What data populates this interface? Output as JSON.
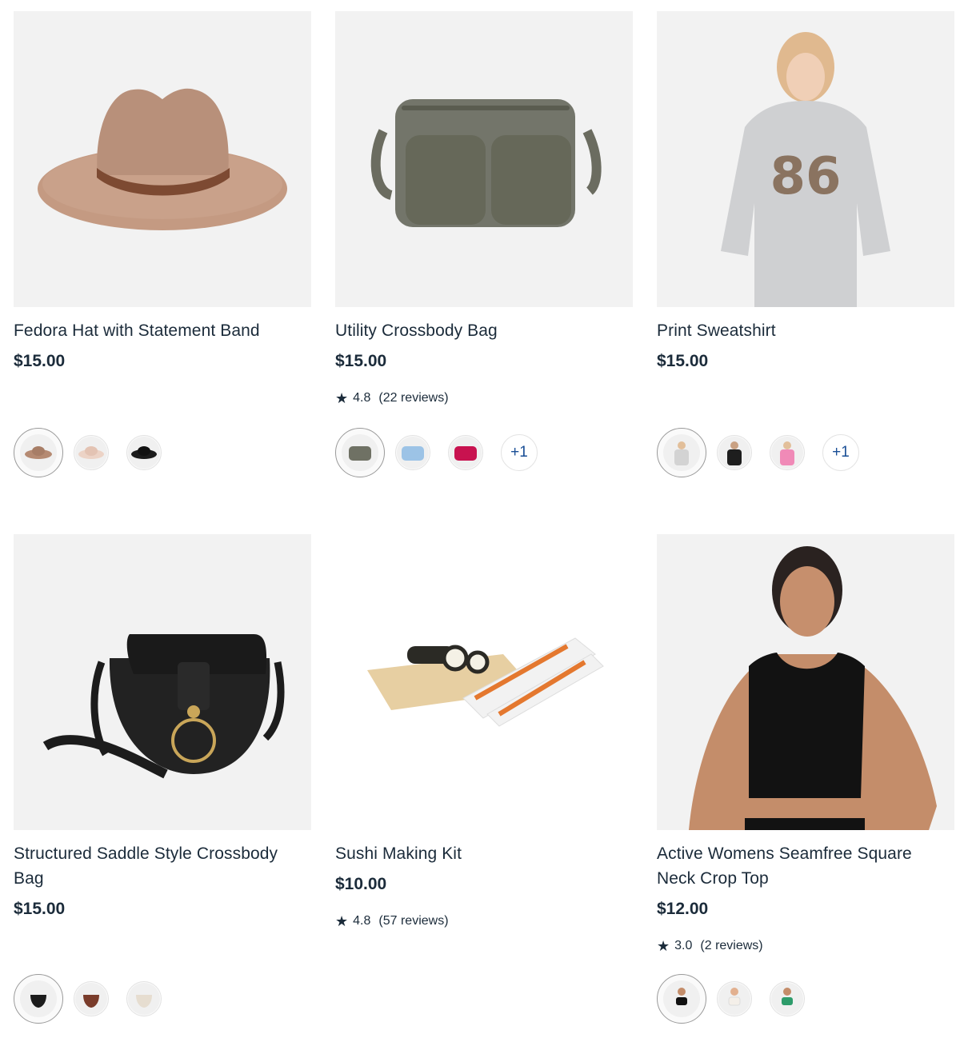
{
  "products": [
    {
      "title": "Fedora Hat with Statement Band",
      "price": "$15.00",
      "image": "fedora-hat-image",
      "swatches": [
        "tan-fedora",
        "blush-fedora",
        "black-fedora"
      ],
      "colors": [
        "#b58a72",
        "#ecd3c6",
        "#1b1b1b"
      ]
    },
    {
      "title": "Utility Crossbody Bag",
      "price": "$15.00",
      "rating": "4.8",
      "reviews": "(22 reviews)",
      "image": "crossbody-bag-image",
      "swatches": [
        "khaki-bag",
        "blue-bag",
        "pink-bag"
      ],
      "colors": [
        "#6f7164",
        "#9cc3e6",
        "#c8124f"
      ],
      "more": "+1"
    },
    {
      "title": "Print Sweatshirt",
      "price": "$15.00",
      "image": "sweatshirt-image",
      "swatches": [
        "grey-sweatshirt",
        "black-sweatshirt",
        "pink-sweatshirt"
      ],
      "colors": [
        "#d3d3d3",
        "#1e1e1e",
        "#f08ab7"
      ],
      "more": "+1"
    },
    {
      "title": "Structured Saddle Style Crossbody Bag",
      "price": "$15.00",
      "image": "saddle-bag-image",
      "swatches": [
        "black-saddle-bag",
        "brown-saddle-bag",
        "cream-saddle-bag"
      ],
      "colors": [
        "#1c1c1c",
        "#7a3c2b",
        "#e6ddd0"
      ]
    },
    {
      "title": "Sushi Making Kit",
      "price": "$10.00",
      "rating": "4.8",
      "reviews": "(57 reviews)",
      "image": "sushi-kit-image"
    },
    {
      "title": "Active Womens Seamfree Square Neck Crop Top",
      "price": "$12.00",
      "rating": "3.0",
      "reviews": "(2 reviews)",
      "image": "crop-top-image",
      "swatches": [
        "black-crop-top",
        "white-crop-top",
        "green-crop-top"
      ],
      "colors": [
        "#111111",
        "#f4efe9",
        "#2e9c6b"
      ]
    }
  ]
}
